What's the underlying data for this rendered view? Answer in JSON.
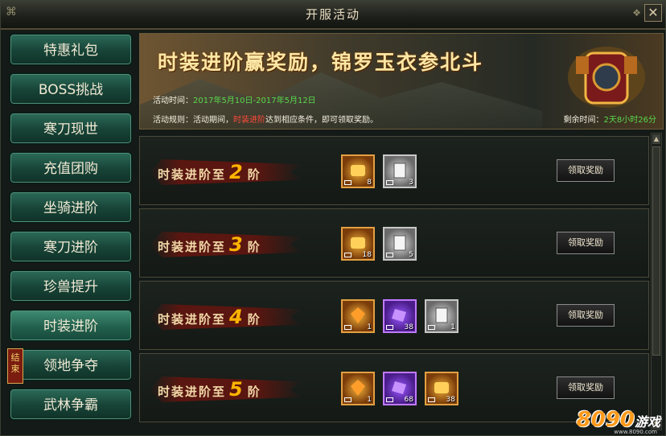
{
  "window": {
    "title": "开服活动",
    "close_label": "✕"
  },
  "sidebar": {
    "items": [
      {
        "label": "特惠礼包"
      },
      {
        "label": "BOSS挑战"
      },
      {
        "label": "寒刀现世"
      },
      {
        "label": "充值团购"
      },
      {
        "label": "坐骑进阶"
      },
      {
        "label": "寒刀进阶"
      },
      {
        "label": "珍兽提升"
      },
      {
        "label": "时装进阶"
      },
      {
        "label": "领地争夺",
        "tag": "结束"
      },
      {
        "label": "武林争霸"
      }
    ]
  },
  "banner": {
    "title": "时装进阶赢奖励，锦罗玉衣参北斗",
    "time_label": "活动时间：",
    "time_value": "2017年5月10日-2017年5月12日",
    "rule_label": "活动规则：活动期间，",
    "rule_highlight": "时装进阶",
    "rule_text": "达到相应条件，即可领取奖励。",
    "remain_label": "剩余时间：",
    "remain_value": "2天8小时26分"
  },
  "rewards": [
    {
      "label_pre": "时装进阶至",
      "level": "2",
      "label_post": "阶",
      "button": "领取奖励",
      "items": [
        {
          "type": "gold",
          "count": "8"
        },
        {
          "type": "silver",
          "count": "3"
        }
      ]
    },
    {
      "label_pre": "时装进阶至",
      "level": "3",
      "label_post": "阶",
      "button": "领取奖励",
      "items": [
        {
          "type": "gold",
          "count": "18"
        },
        {
          "type": "silver",
          "count": "5"
        }
      ]
    },
    {
      "label_pre": "时装进阶至",
      "level": "4",
      "label_post": "阶",
      "button": "领取奖励",
      "items": [
        {
          "type": "gold",
          "count": "1"
        },
        {
          "type": "purple",
          "count": "38"
        },
        {
          "type": "silver",
          "count": "1"
        }
      ]
    },
    {
      "label_pre": "时装进阶至",
      "level": "5",
      "label_post": "阶",
      "button": "领取奖励",
      "items": [
        {
          "type": "gold",
          "count": "1"
        },
        {
          "type": "purple",
          "count": "68"
        },
        {
          "type": "gold",
          "count": "38"
        }
      ]
    }
  ],
  "watermark": {
    "brand": "8090",
    "suffix": "游戏",
    "url": "www.8090.com"
  }
}
